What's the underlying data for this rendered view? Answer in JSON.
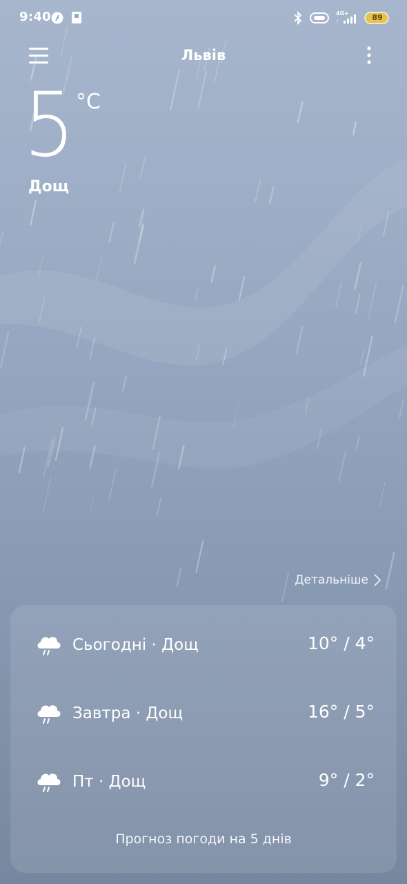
{
  "status_bar": {
    "time": "9:40",
    "network": "4G+",
    "battery": "89",
    "icons": [
      "notification-app-icon",
      "sim-card-icon",
      "bluetooth-icon",
      "vibrate-icon",
      "signal-icon",
      "battery-icon"
    ]
  },
  "header": {
    "city": "Львів",
    "menu_icon": "menu-icon",
    "more_icon": "more-icon"
  },
  "current": {
    "temperature": "5",
    "unit": "°C",
    "condition": "Дощ"
  },
  "details_label": "Детальніше",
  "forecast": [
    {
      "label": "Сьогодні · Дощ",
      "temps": "10° / 4°",
      "icon": "rain-cloud-icon"
    },
    {
      "label": "Завтра · Дощ",
      "temps": "16° / 5°",
      "icon": "rain-cloud-icon"
    },
    {
      "label": "Пт · Дощ",
      "temps": "9° / 2°",
      "icon": "rain-cloud-icon"
    }
  ],
  "forecast_button": "Прогноз погоди на 5 днів",
  "colors": {
    "sky_top": "#a7b6cd",
    "sky_bottom": "#76879f",
    "battery": "#e8c24a"
  }
}
